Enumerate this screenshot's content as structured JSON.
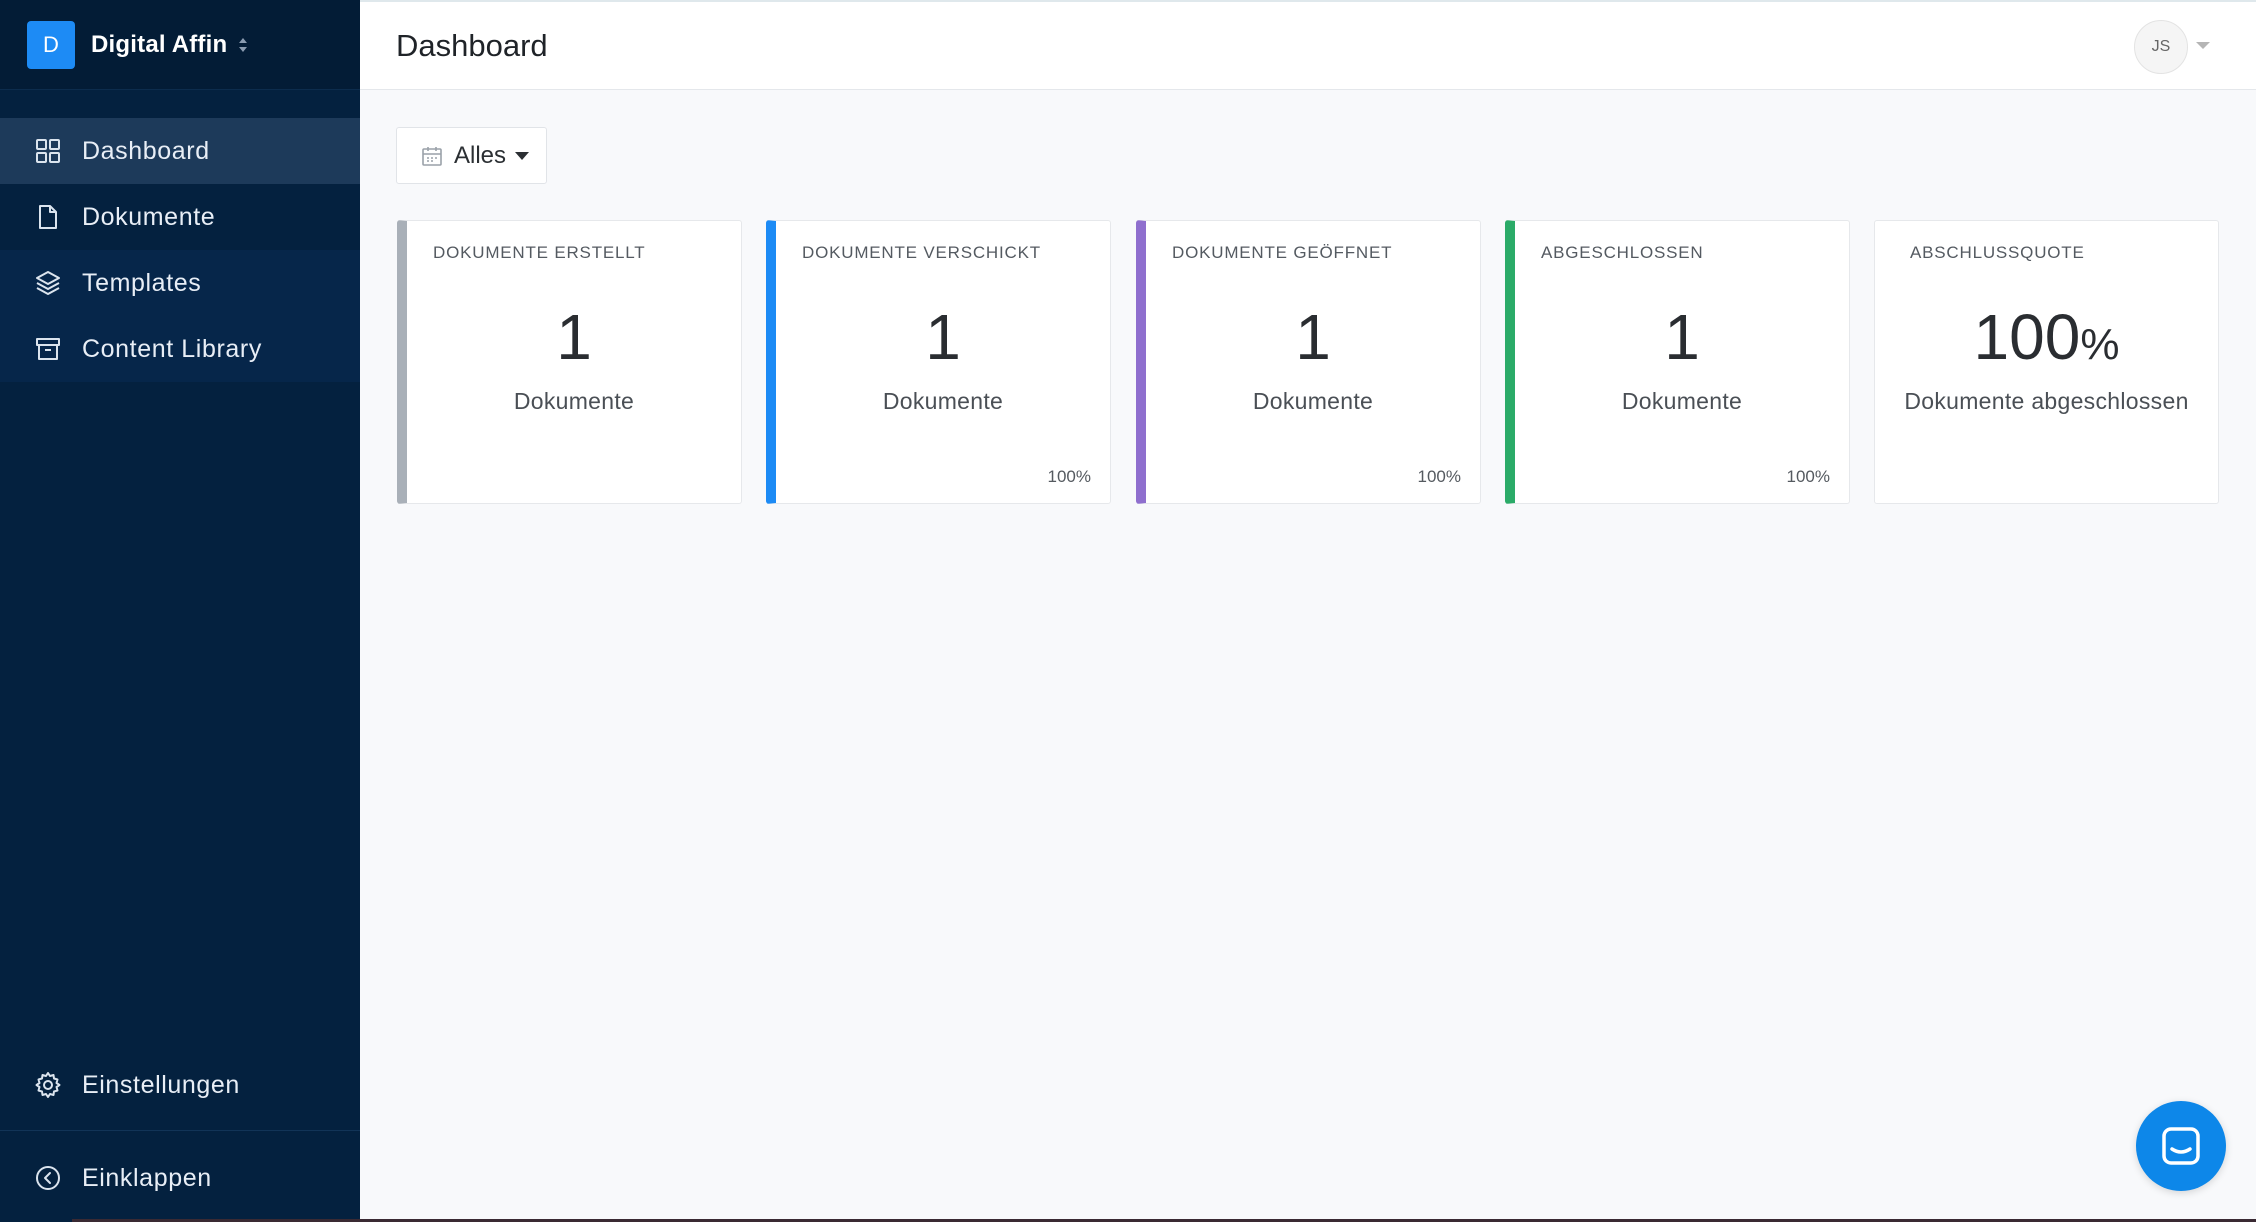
{
  "sidebar": {
    "brand": {
      "initial": "D",
      "name": "Digital Affin"
    },
    "items": [
      {
        "label": "Dashboard",
        "icon": "grid-icon",
        "active": true
      },
      {
        "label": "Dokumente",
        "icon": "file-icon"
      },
      {
        "label": "Templates",
        "icon": "layers-icon"
      },
      {
        "label": "Content Library",
        "icon": "archive-icon"
      }
    ],
    "bottom": [
      {
        "label": "Einstellungen",
        "icon": "gear-icon"
      },
      {
        "label": "Einklappen",
        "icon": "chevron-left-circle-icon"
      }
    ]
  },
  "header": {
    "title": "Dashboard",
    "user_initials": "JS"
  },
  "filter": {
    "label": "Alles",
    "icon": "calendar-icon"
  },
  "cards": [
    {
      "label": "DOKUMENTE ERSTELLT",
      "value": "1",
      "unit": "Dokumente",
      "percent": "",
      "accent": "#a9b0b8"
    },
    {
      "label": "DOKUMENTE VERSCHICKT",
      "value": "1",
      "unit": "Dokumente",
      "percent": "100%",
      "accent": "#1d8bf5"
    },
    {
      "label": "DOKUMENTE GEÖFFNET",
      "value": "1",
      "unit": "Dokumente",
      "percent": "100%",
      "accent": "#8f6fce"
    },
    {
      "label": "ABGESCHLOSSEN",
      "value": "1",
      "unit": "Dokumente",
      "percent": "100%",
      "accent": "#2bab68"
    },
    {
      "label": "ABSCHLUSSQUOTE",
      "value": "100",
      "value_suffix": "%",
      "unit": "Dokumente abgeschlossen",
      "percent": "",
      "accent": "#e6e8eb"
    }
  ],
  "colors": {
    "sidebar_bg": "#04213f",
    "sidebar_active": "#1d3a5a",
    "brand_badge": "#1d8bf5",
    "chat_button": "#0d87e9"
  },
  "chat": {
    "icon": "chat-bubble-icon"
  }
}
